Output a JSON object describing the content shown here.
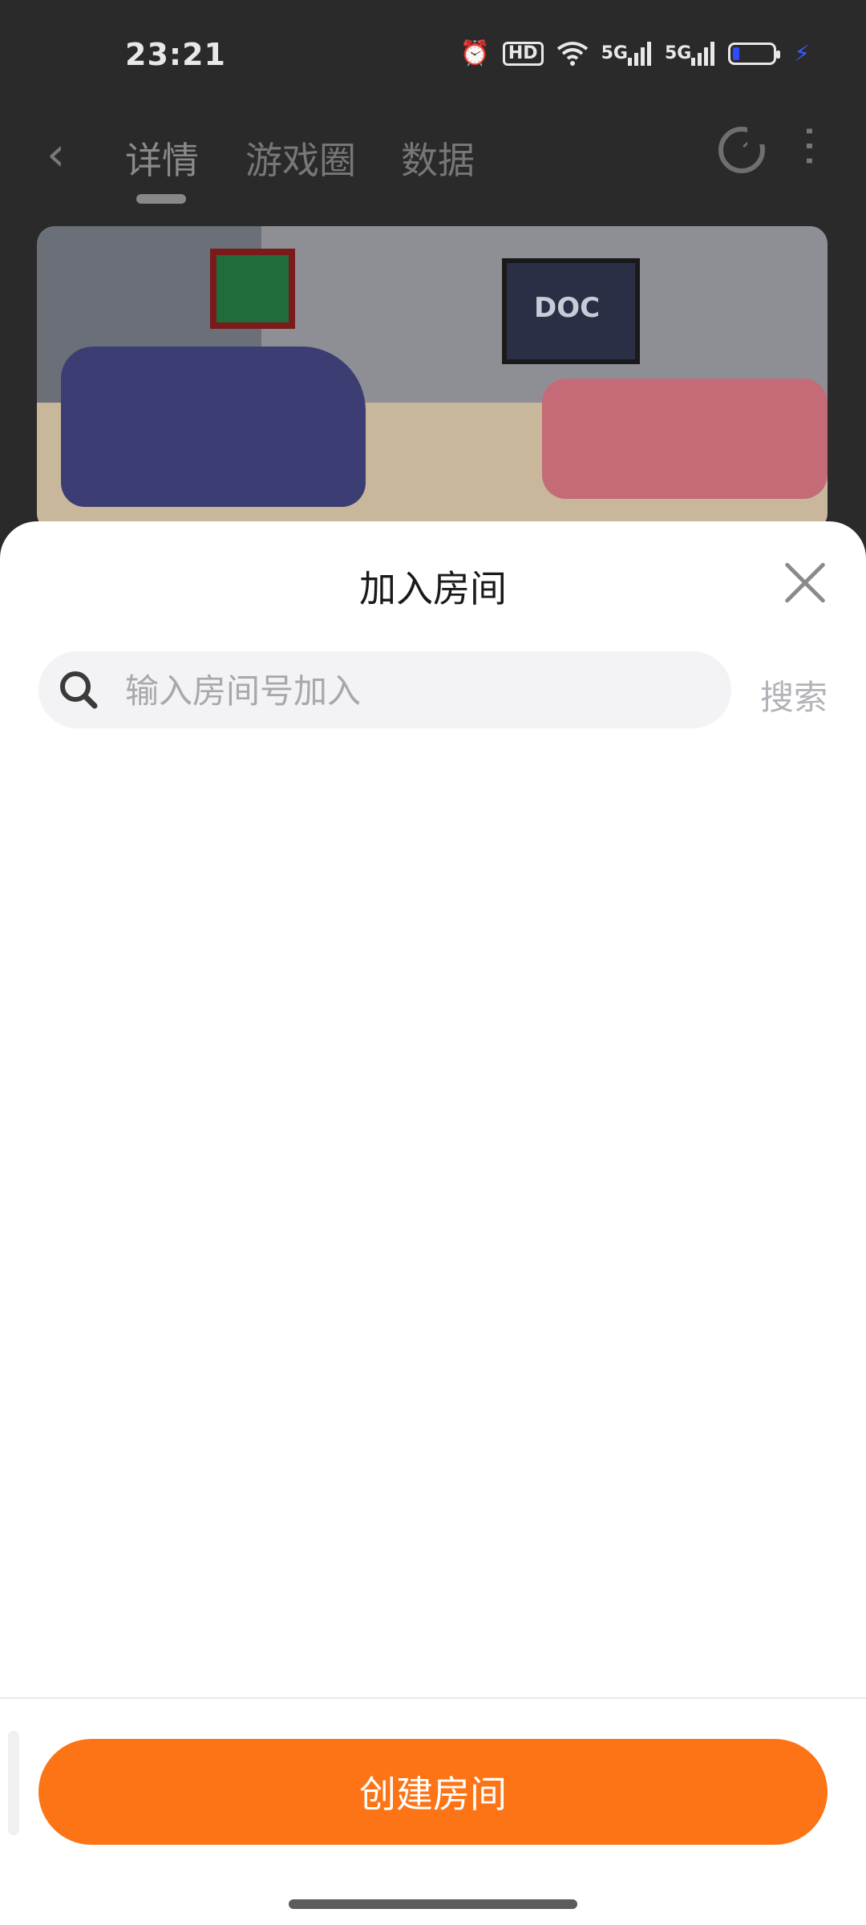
{
  "status_bar": {
    "time": "23:21",
    "icons": [
      "alarm-icon",
      "hd-voice-icon",
      "wifi-icon",
      "5g-signal-icon",
      "5g-signal-icon",
      "battery-icon",
      "charging-icon"
    ],
    "hd_label": "HD",
    "signal_labels": [
      "5G",
      "5G"
    ]
  },
  "top_nav": {
    "tabs": [
      {
        "label": "详情",
        "active": true
      },
      {
        "label": "游戏圈",
        "active": false
      },
      {
        "label": "数据",
        "active": false
      }
    ]
  },
  "banner": {
    "tv_text": "DOC"
  },
  "sheet": {
    "title": "加入房间",
    "search": {
      "placeholder": "输入房间号加入",
      "value": "",
      "button_label": "搜索"
    },
    "create_button_label": "创建房间"
  },
  "colors": {
    "accent": "#fc7416",
    "battery_fill": "#2d4cff"
  }
}
